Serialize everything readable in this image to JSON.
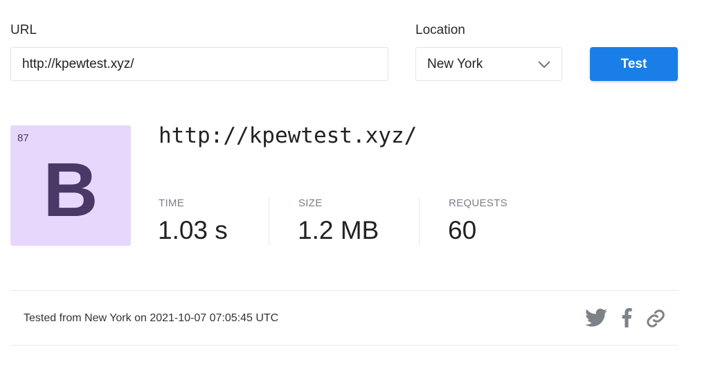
{
  "form": {
    "url_label": "URL",
    "url_value": "http://kpewtest.xyz/",
    "location_label": "Location",
    "location_value": "New York",
    "test_label": "Test"
  },
  "result": {
    "score": "87",
    "grade": "B",
    "grade_color": "#e6d8fd",
    "grade_text_color": "#4a3866",
    "url": "http://kpewtest.xyz/",
    "metrics": [
      {
        "label": "TIME",
        "value": "1.03 s"
      },
      {
        "label": "SIZE",
        "value": "1.2 MB"
      },
      {
        "label": "REQUESTS",
        "value": "60"
      }
    ]
  },
  "footer": {
    "tested_text": "Tested from New York on 2021-10-07 07:05:45 UTC",
    "share_icons": [
      "twitter-icon",
      "facebook-icon",
      "link-icon"
    ]
  }
}
